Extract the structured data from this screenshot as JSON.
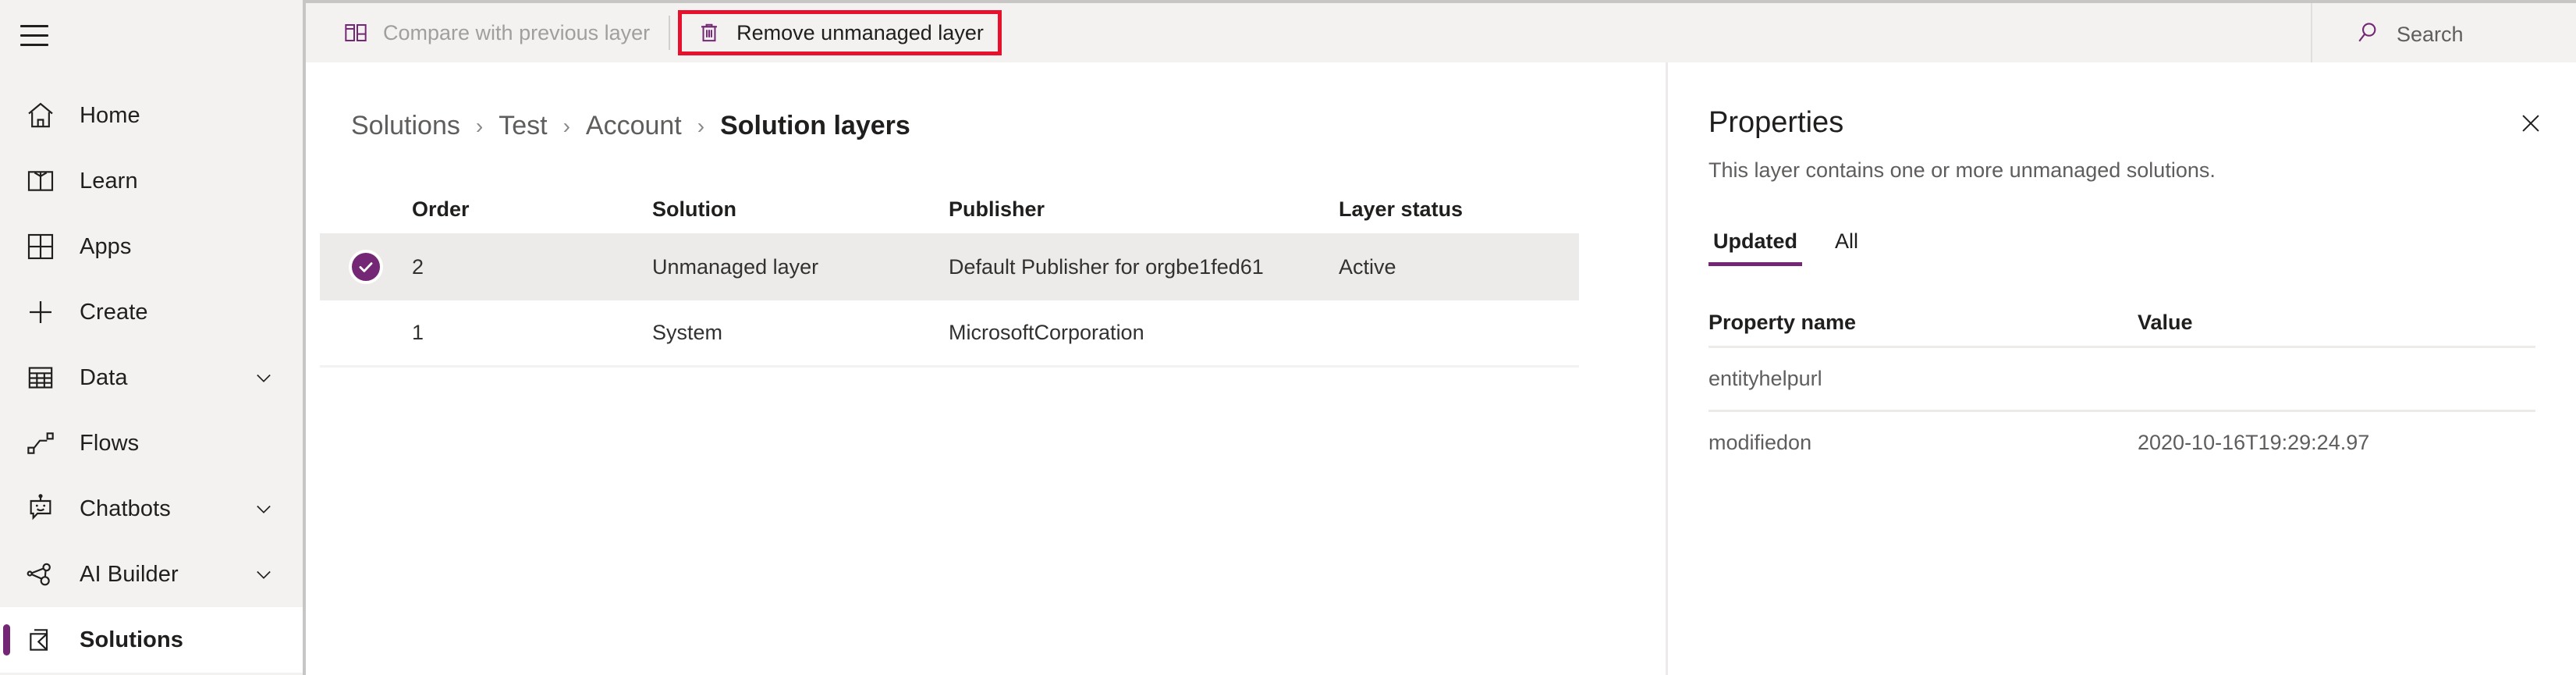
{
  "sidebar": {
    "menu_button": "menu-hamburger",
    "items": [
      {
        "label": "Home",
        "icon": "home-icon",
        "chevron": false,
        "active": false
      },
      {
        "label": "Learn",
        "icon": "book-icon",
        "chevron": false,
        "active": false
      },
      {
        "label": "Apps",
        "icon": "apps-grid-icon",
        "chevron": false,
        "active": false
      },
      {
        "label": "Create",
        "icon": "plus-icon",
        "chevron": false,
        "active": false
      },
      {
        "label": "Data",
        "icon": "table-icon",
        "chevron": true,
        "active": false
      },
      {
        "label": "Flows",
        "icon": "flow-icon",
        "chevron": false,
        "active": false
      },
      {
        "label": "Chatbots",
        "icon": "robot-icon",
        "chevron": true,
        "active": false
      },
      {
        "label": "AI Builder",
        "icon": "ai-builder-icon",
        "chevron": true,
        "active": false
      },
      {
        "label": "Solutions",
        "icon": "solutions-icon",
        "chevron": false,
        "active": true
      }
    ]
  },
  "commandbar": {
    "compare_label": "Compare with previous layer",
    "compare_icon": "compare-panels-icon",
    "remove_label": "Remove unmanaged layer",
    "remove_icon": "trash-icon",
    "remove_highlight_color": "#e8112d",
    "search_label": "Search",
    "search_icon": "search-icon"
  },
  "breadcrumb": {
    "items": [
      "Solutions",
      "Test",
      "Account",
      "Solution layers"
    ],
    "separator": "›"
  },
  "layers_table": {
    "columns": [
      "Order",
      "Solution",
      "Publisher",
      "Layer status"
    ],
    "rows": [
      {
        "selected": true,
        "order": "2",
        "solution": "Unmanaged layer",
        "publisher": "Default Publisher for orgbe1fed61",
        "status": "Active"
      },
      {
        "selected": false,
        "order": "1",
        "solution": "System",
        "publisher": "MicrosoftCorporation",
        "status": ""
      }
    ]
  },
  "properties": {
    "title": "Properties",
    "subtitle": "This layer contains one or more unmanaged solutions.",
    "close_icon": "close-icon",
    "tabs": [
      {
        "label": "Updated",
        "active": true
      },
      {
        "label": "All",
        "active": false
      }
    ],
    "columns": [
      "Property name",
      "Value"
    ],
    "rows": [
      {
        "name": "entityhelpurl",
        "value": ""
      },
      {
        "name": "modifiedon",
        "value": "2020-10-16T19:29:24.97"
      }
    ]
  },
  "theme": {
    "accent": "#742774",
    "selected_row_bg": "#edebe9",
    "chrome_bg": "#f3f2f1",
    "muted_text": "#605e5c"
  }
}
